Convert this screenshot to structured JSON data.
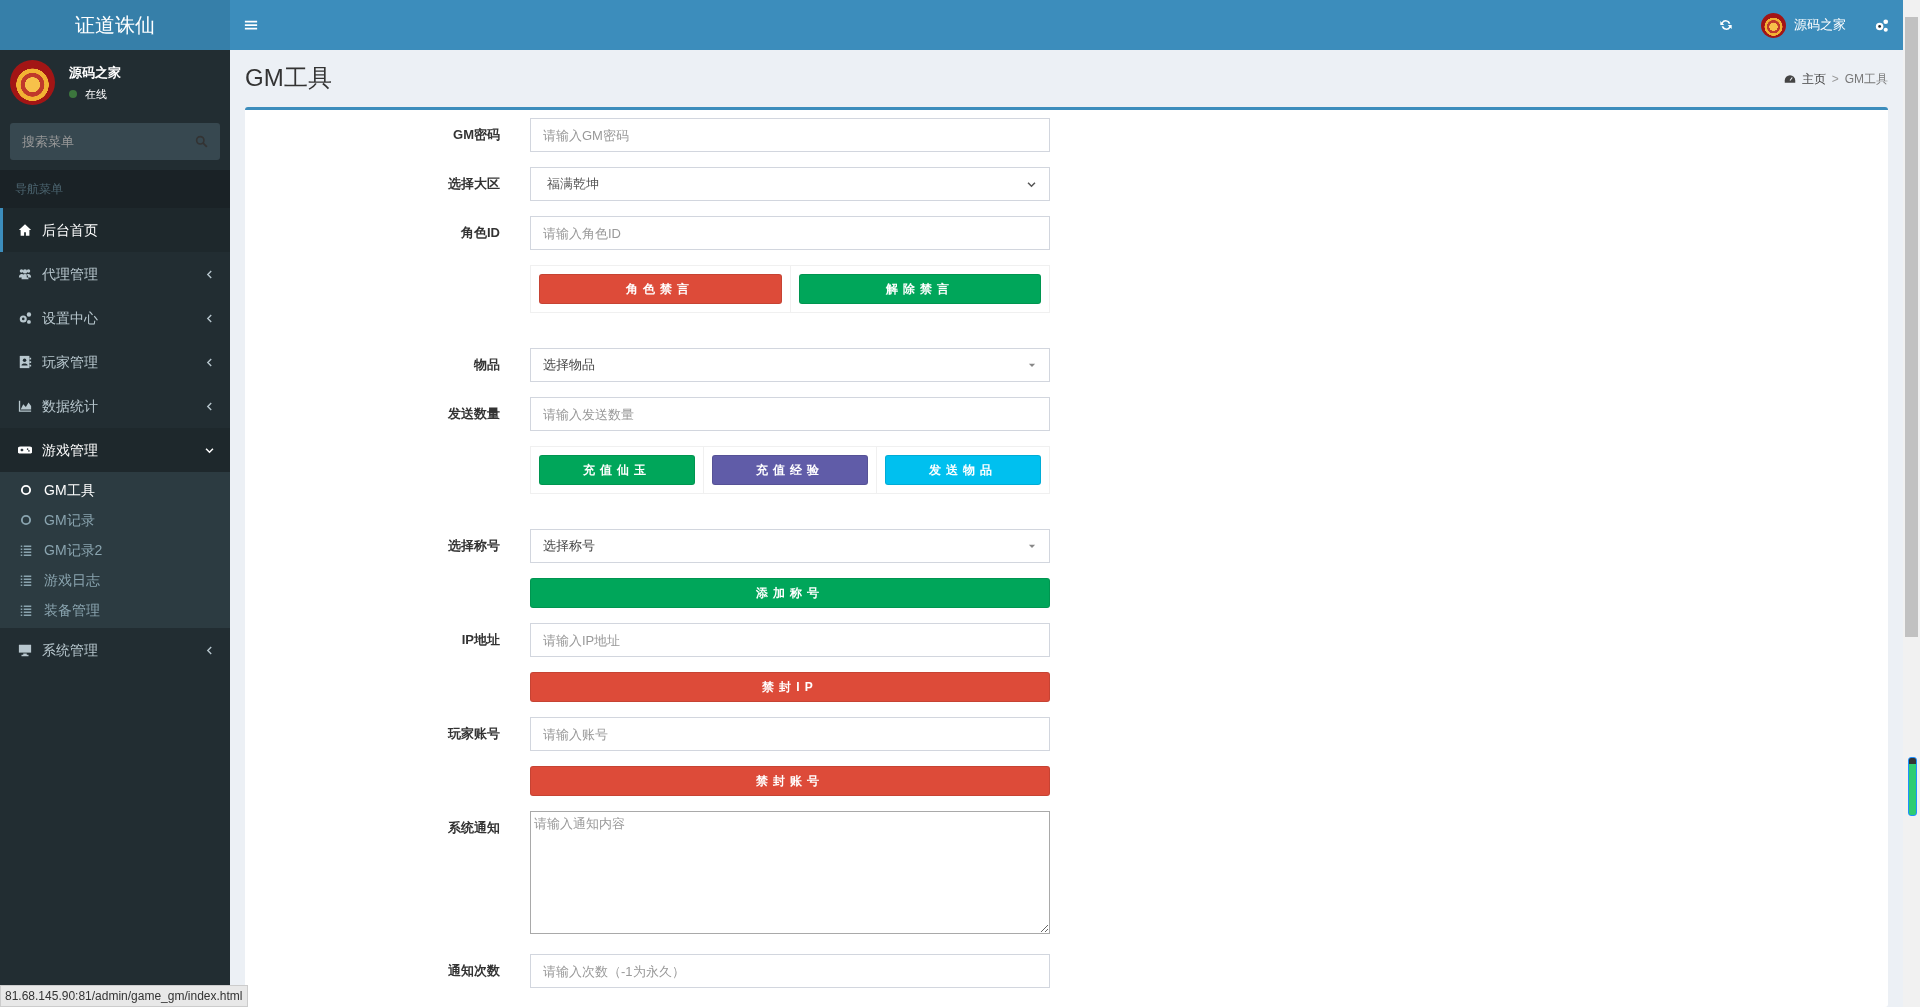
{
  "app": {
    "title": "证道诛仙"
  },
  "topbar": {
    "user_name": "源码之家"
  },
  "user": {
    "name": "源码之家",
    "status": "在线"
  },
  "sidebar": {
    "search": {
      "placeholder": "搜索菜单"
    },
    "header": "导航菜单",
    "items": [
      {
        "label": "后台首页",
        "selected": true
      },
      {
        "label": "代理管理",
        "selected": false,
        "expanded": false
      },
      {
        "label": "设置中心",
        "selected": false,
        "expanded": false
      },
      {
        "label": "玩家管理",
        "selected": false,
        "expanded": false
      },
      {
        "label": "数据统计",
        "selected": false,
        "expanded": false
      },
      {
        "label": "游戏管理",
        "selected": false,
        "expanded": true,
        "children": [
          {
            "label": "GM工具",
            "selected": true
          },
          {
            "label": "GM记录",
            "selected": false
          },
          {
            "label": "GM记录2",
            "selected": false
          },
          {
            "label": "游戏日志",
            "selected": false
          },
          {
            "label": "装备管理",
            "selected": false
          }
        ]
      },
      {
        "label": "系统管理",
        "selected": false,
        "expanded": false
      }
    ]
  },
  "page": {
    "title": "GM工具",
    "breadcrumb": [
      "主页",
      "GM工具"
    ],
    "breadcrumb_separator": ">"
  },
  "form": [
    {
      "kind": "input",
      "label": "GM密码",
      "placeholder": "请输入GM密码"
    },
    {
      "kind": "select",
      "label": "选择大区",
      "value": "福满乾坤"
    },
    {
      "kind": "input",
      "label": "角色ID",
      "placeholder": "请输入角色ID"
    },
    {
      "kind": "buttons",
      "buttons": [
        {
          "label": "角色禁言",
          "color": "#dd4b39"
        },
        {
          "label": "解除禁言",
          "color": "#00a65a"
        }
      ]
    },
    {
      "kind": "dropdown",
      "label": "物品",
      "value": "选择物品"
    },
    {
      "kind": "input",
      "label": "发送数量",
      "placeholder": "请输入发送数量"
    },
    {
      "kind": "buttons",
      "buttons": [
        {
          "label": "充值仙玉",
          "color": "#00a65a"
        },
        {
          "label": "充值经验",
          "color": "#605ca8"
        },
        {
          "label": "发送物品",
          "color": "#00c0ef"
        }
      ]
    },
    {
      "kind": "dropdown",
      "label": "选择称号",
      "value": "选择称号"
    },
    {
      "kind": "button",
      "label": "添加称号",
      "color": "#00a65a"
    },
    {
      "kind": "input",
      "label": "IP地址",
      "placeholder": "请输入IP地址"
    },
    {
      "kind": "button",
      "label": "禁封IP",
      "color": "#dd4b39"
    },
    {
      "kind": "input",
      "label": "玩家账号",
      "placeholder": "请输入账号"
    },
    {
      "kind": "button",
      "label": "禁封账号",
      "color": "#dd4b39"
    },
    {
      "kind": "textarea",
      "label": "系统通知",
      "placeholder": "请输入通知内容"
    },
    {
      "kind": "input",
      "label": "通知次数",
      "placeholder": "请输入次数（-1为永久）"
    }
  ],
  "status_url": "81.68.145.90:81/admin/game_gm/index.html"
}
